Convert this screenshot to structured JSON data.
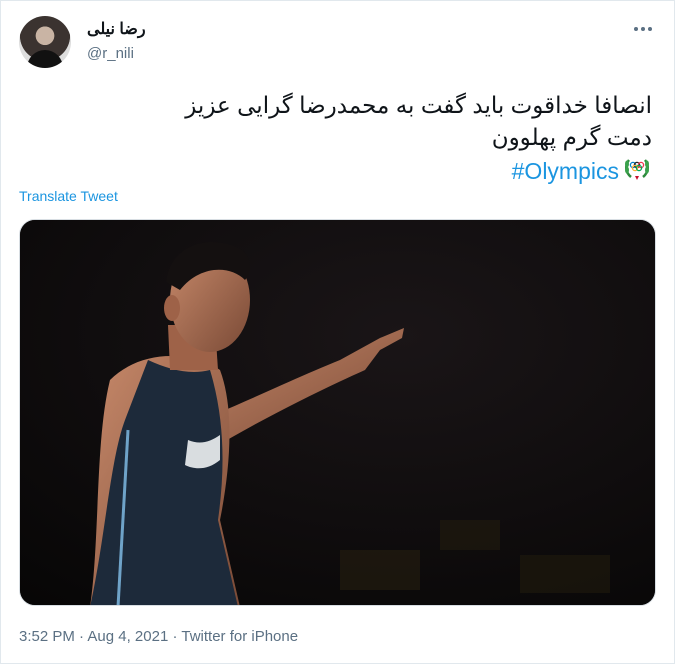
{
  "user": {
    "display_name": "رضا نیلی",
    "handle": "@r_nili"
  },
  "tweet": {
    "line1": "انصافا خداقوت باید گفت به محمدرضا گرایی عزیز",
    "line2": "دمت گرم پهلوون",
    "hashtag": "#Olympics"
  },
  "translate_label": "Translate Tweet",
  "meta": {
    "time": "3:52 PM",
    "date": "Aug 4, 2021",
    "source": "Twitter for iPhone",
    "separator": " · "
  },
  "colors": {
    "link": "#1b95e0",
    "secondary_text": "#5b7083"
  },
  "icons": {
    "more": "more-horizontal-icon",
    "olympic": "olympic-laurel-icon"
  }
}
